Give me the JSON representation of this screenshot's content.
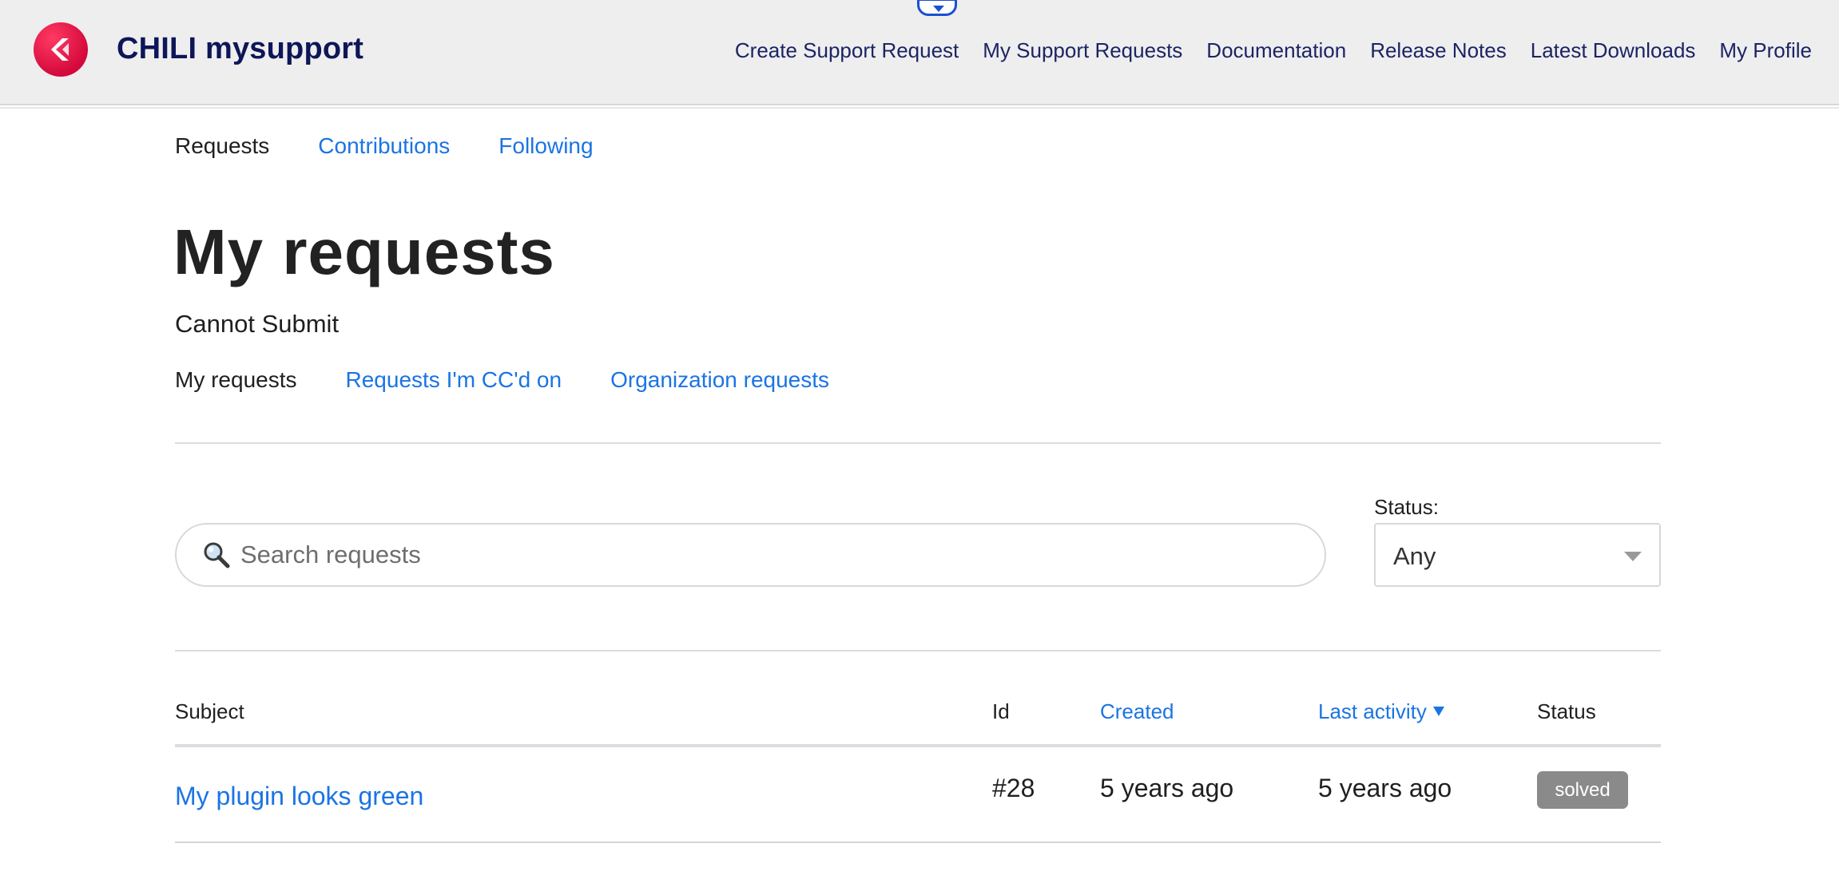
{
  "header": {
    "brand": "CHILI mysupport",
    "nav": [
      "Create Support Request",
      "My Support Requests",
      "Documentation",
      "Release Notes",
      "Latest Downloads",
      "My Profile"
    ]
  },
  "subnav": {
    "active": "Requests",
    "links": [
      "Contributions",
      "Following"
    ]
  },
  "page": {
    "title": "My requests",
    "subtitle": "Cannot Submit"
  },
  "filter_tabs": {
    "active": "My requests",
    "links": [
      "Requests I'm CC'd on",
      "Organization requests"
    ]
  },
  "search": {
    "placeholder": "Search requests",
    "icon": "magnifier-icon"
  },
  "status_filter": {
    "label": "Status:",
    "value": "Any"
  },
  "table": {
    "columns": {
      "subject": "Subject",
      "id": "Id",
      "created": "Created",
      "last_activity": "Last activity",
      "status": "Status"
    },
    "sort_column": "Last activity",
    "rows": [
      {
        "subject": "My plugin looks green",
        "id": "#28",
        "created": "5 years ago",
        "last_activity": "5 years ago",
        "status": "solved"
      }
    ]
  },
  "colors": {
    "link": "#1b74e4",
    "brand_text": "#0d1657",
    "logo": "#e8174a",
    "badge": "#8a8a8a"
  }
}
